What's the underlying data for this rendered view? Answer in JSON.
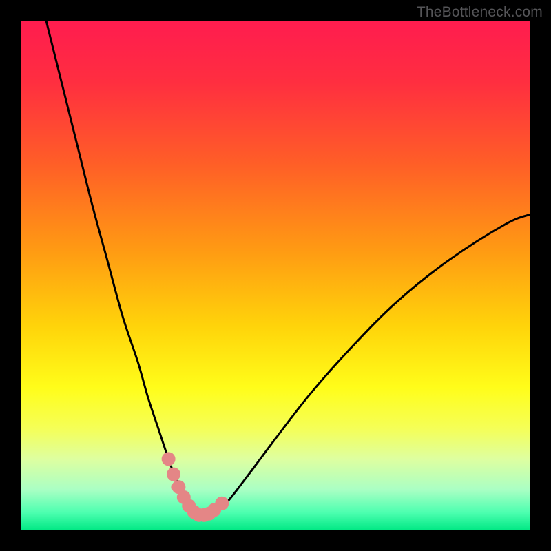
{
  "watermark": "TheBottleneck.com",
  "colors": {
    "frame": "#000000",
    "gradient_stops": [
      {
        "offset": 0.0,
        "color": "#ff1c4f"
      },
      {
        "offset": 0.12,
        "color": "#ff2e40"
      },
      {
        "offset": 0.28,
        "color": "#ff5e27"
      },
      {
        "offset": 0.45,
        "color": "#ff9a13"
      },
      {
        "offset": 0.6,
        "color": "#ffd40a"
      },
      {
        "offset": 0.72,
        "color": "#fffd1a"
      },
      {
        "offset": 0.8,
        "color": "#f5ff57"
      },
      {
        "offset": 0.86,
        "color": "#deffa0"
      },
      {
        "offset": 0.92,
        "color": "#aaffc4"
      },
      {
        "offset": 0.965,
        "color": "#4dffb0"
      },
      {
        "offset": 1.0,
        "color": "#00e884"
      }
    ],
    "curve": "#000000",
    "marker_fill": "#e48686",
    "marker_stroke": "#e48686"
  },
  "chart_data": {
    "type": "line",
    "title": "",
    "xlabel": "",
    "ylabel": "",
    "xlim": [
      0,
      100
    ],
    "ylim": [
      0,
      100
    ],
    "grid": false,
    "series": [
      {
        "name": "bottleneck-curve",
        "x": [
          5,
          8,
          11,
          14,
          17,
          20,
          23,
          25,
          27,
          29,
          30.5,
          32,
          33.5,
          35,
          37,
          40,
          44,
          50,
          57,
          65,
          74,
          84,
          95,
          100
        ],
        "values": [
          100,
          88,
          76,
          64,
          53,
          42,
          33,
          26,
          20,
          14,
          10,
          7,
          4.5,
          3,
          3,
          5,
          10,
          18,
          27,
          36,
          45,
          53,
          60,
          62
        ]
      }
    ],
    "markers": {
      "name": "highlight-markers",
      "x_values": [
        29,
        30,
        31,
        32,
        33,
        34,
        35,
        36,
        37,
        38,
        39.5
      ],
      "bottleneck_values": [
        14,
        11,
        8.5,
        6.5,
        4.8,
        3.6,
        3,
        3,
        3.3,
        4,
        5.3
      ]
    }
  }
}
